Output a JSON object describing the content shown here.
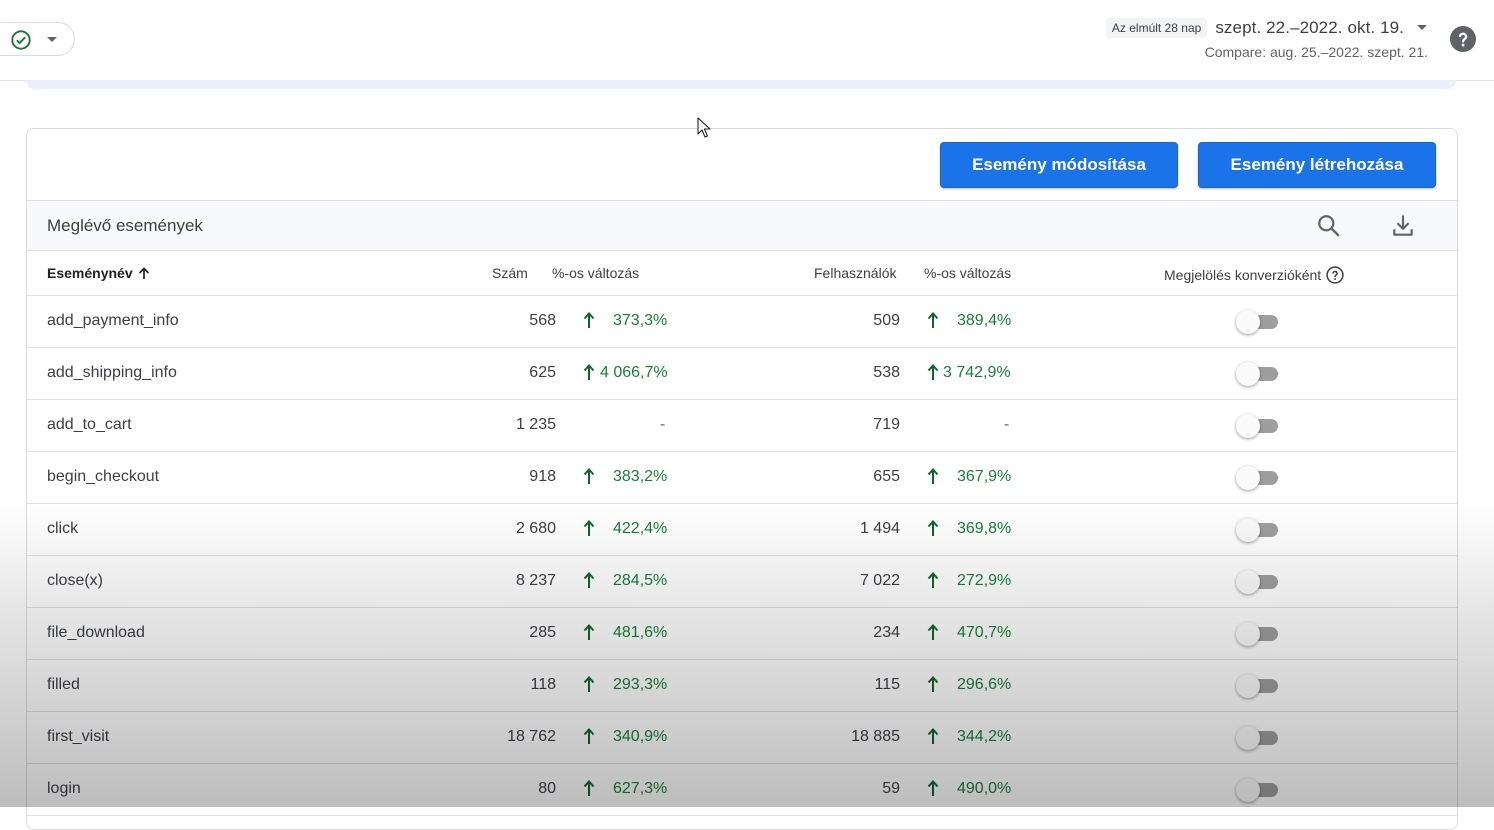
{
  "header": {
    "date_chip": "Az elmúlt 28 nap",
    "date_range": "szept. 22.–2022. okt. 19.",
    "compare": "Compare: aug. 25.–2022. szept. 21."
  },
  "actions": {
    "modify_label": "Esemény módosítása",
    "create_label": "Esemény létrehozása"
  },
  "section": {
    "title": "Meglévő események"
  },
  "columns": {
    "name": "Eseménynév",
    "count": "Szám",
    "change1": "%-os változás",
    "users": "Felhasználók",
    "change2": "%-os változás",
    "conversion": "Megjelölés konverzióként"
  },
  "rows": [
    {
      "name": "add_payment_info",
      "count": "568",
      "change1": "373,3%",
      "users": "509",
      "change2": "389,4%",
      "conversion": false
    },
    {
      "name": "add_shipping_info",
      "count": "625",
      "change1": "4 066,7%",
      "users": "538",
      "change2": "3 742,9%",
      "conversion": false
    },
    {
      "name": "add_to_cart",
      "count": "1 235",
      "change1": "-",
      "users": "719",
      "change2": "-",
      "conversion": false
    },
    {
      "name": "begin_checkout",
      "count": "918",
      "change1": "383,2%",
      "users": "655",
      "change2": "367,9%",
      "conversion": false
    },
    {
      "name": "click",
      "count": "2 680",
      "change1": "422,4%",
      "users": "1 494",
      "change2": "369,8%",
      "conversion": false
    },
    {
      "name": "close(x)",
      "count": "8 237",
      "change1": "284,5%",
      "users": "7 022",
      "change2": "272,9%",
      "conversion": false
    },
    {
      "name": "file_download",
      "count": "285",
      "change1": "481,6%",
      "users": "234",
      "change2": "470,7%",
      "conversion": false
    },
    {
      "name": "filled",
      "count": "118",
      "change1": "293,3%",
      "users": "115",
      "change2": "296,6%",
      "conversion": false
    },
    {
      "name": "first_visit",
      "count": "18 762",
      "change1": "340,9%",
      "users": "18 885",
      "change2": "344,2%",
      "conversion": false
    },
    {
      "name": "login",
      "count": "80",
      "change1": "627,3%",
      "users": "59",
      "change2": "490,0%",
      "conversion": false
    }
  ],
  "colors": {
    "primary": "#1a73e8",
    "positive": "#188038",
    "arrow": "#0d652d"
  }
}
